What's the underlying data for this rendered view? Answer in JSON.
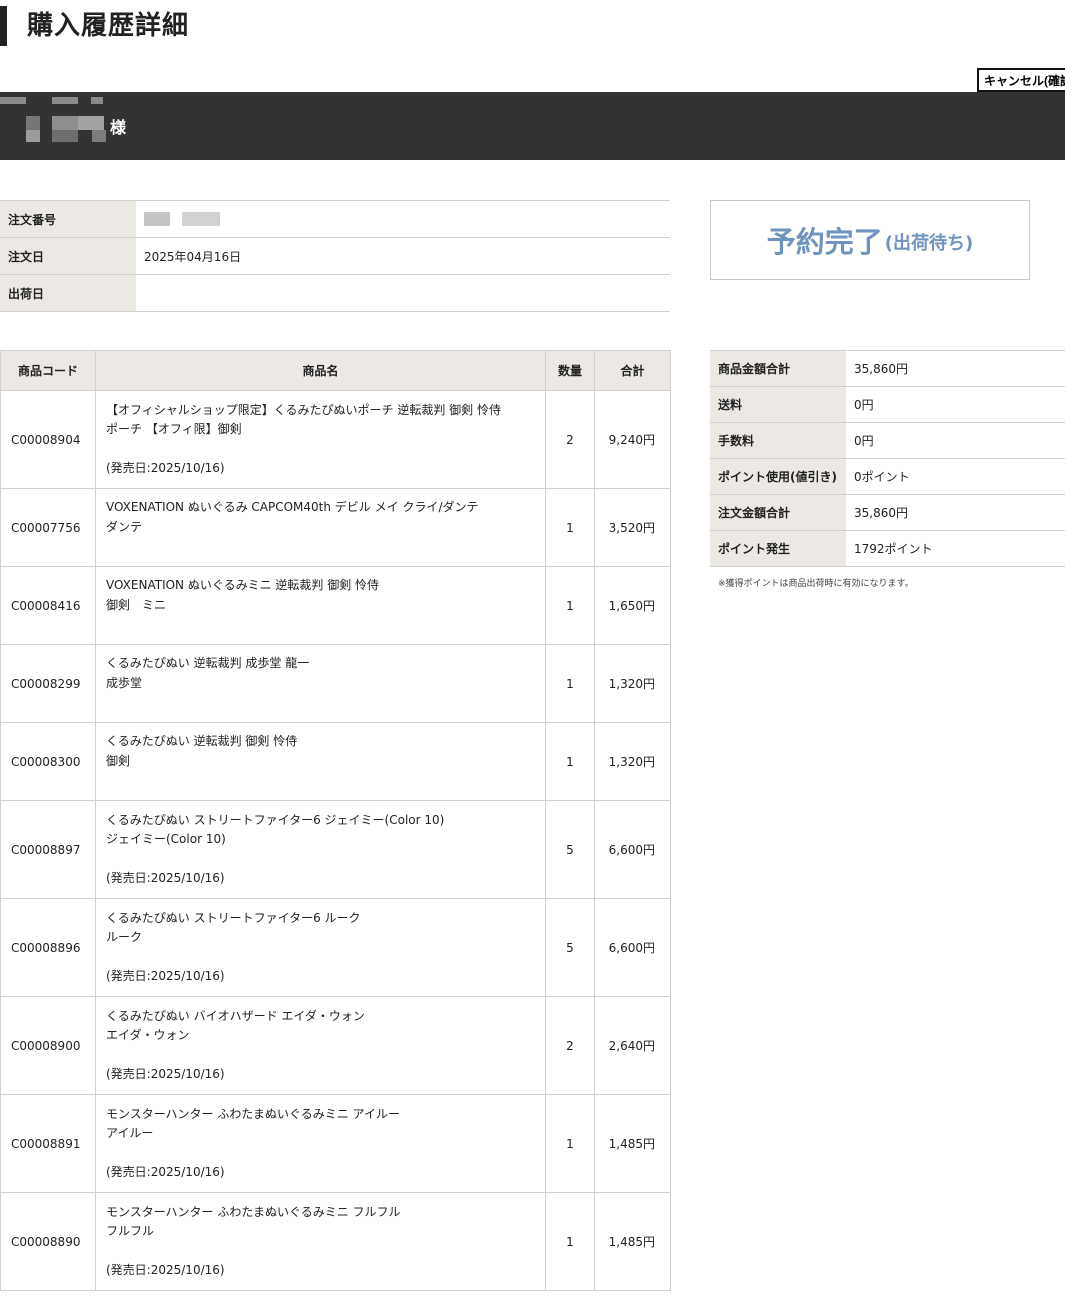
{
  "page": {
    "title": "購入履歴詳細"
  },
  "toolbar": {
    "cancel_label": "キャンセル(確認"
  },
  "customer": {
    "suffix": "様"
  },
  "order_info": {
    "order_number_label": "注文番号",
    "order_date_label": "注文日",
    "order_date": "2025年04月16日",
    "ship_date_label": "出荷日",
    "ship_date": ""
  },
  "status": {
    "main": "予約完了",
    "sub": "(出荷待ち)"
  },
  "items_table": {
    "headers": {
      "code": "商品コード",
      "name": "商品名",
      "qty": "数量",
      "total": "合計"
    },
    "rows": [
      {
        "code": "C00008904",
        "name_line1": "【オフィシャルショップ限定】くるみたぴぬいポーチ 逆転裁判 御剣 怜侍",
        "name_line2": "ポーチ 【オフィ限】御剣",
        "release": "(発売日:2025/10/16)",
        "qty": "2",
        "total": "9,240円"
      },
      {
        "code": "C00007756",
        "name_line1": "VOXENATION ぬいぐるみ CAPCOM40th デビル メイ クライ/ダンテ",
        "name_line2": "ダンテ",
        "release": "",
        "qty": "1",
        "total": "3,520円"
      },
      {
        "code": "C00008416",
        "name_line1": "VOXENATION ぬいぐるみミニ 逆転裁判 御剣 怜侍",
        "name_line2": "御剣　ミニ",
        "release": "",
        "qty": "1",
        "total": "1,650円"
      },
      {
        "code": "C00008299",
        "name_line1": "くるみたぴぬい 逆転裁判 成歩堂 龍一",
        "name_line2": "成歩堂",
        "release": "",
        "qty": "1",
        "total": "1,320円"
      },
      {
        "code": "C00008300",
        "name_line1": "くるみたぴぬい 逆転裁判 御剣 怜侍",
        "name_line2": "御剣",
        "release": "",
        "qty": "1",
        "total": "1,320円"
      },
      {
        "code": "C00008897",
        "name_line1": "くるみたぴぬい ストリートファイター6 ジェイミー(Color 10)",
        "name_line2": "ジェイミー(Color 10)",
        "release": "(発売日:2025/10/16)",
        "qty": "5",
        "total": "6,600円"
      },
      {
        "code": "C00008896",
        "name_line1": "くるみたぴぬい ストリートファイター6 ルーク",
        "name_line2": "ルーク",
        "release": "(発売日:2025/10/16)",
        "qty": "5",
        "total": "6,600円"
      },
      {
        "code": "C00008900",
        "name_line1": "くるみたぴぬい バイオハザード エイダ・ウォン",
        "name_line2": "エイダ・ウォン",
        "release": "(発売日:2025/10/16)",
        "qty": "2",
        "total": "2,640円"
      },
      {
        "code": "C00008891",
        "name_line1": "モンスターハンター ふわたまぬいぐるみミニ アイルー",
        "name_line2": "アイルー",
        "release": "(発売日:2025/10/16)",
        "qty": "1",
        "total": "1,485円"
      },
      {
        "code": "C00008890",
        "name_line1": "モンスターハンター ふわたまぬいぐるみミニ フルフル",
        "name_line2": "フルフル",
        "release": "(発売日:2025/10/16)",
        "qty": "1",
        "total": "1,485円"
      }
    ]
  },
  "totals": {
    "rows": [
      {
        "label": "商品金額合計",
        "value": "35,860円"
      },
      {
        "label": "送料",
        "value": "0円"
      },
      {
        "label": "手数料",
        "value": "0円"
      },
      {
        "label": "ポイント使用(値引き)",
        "value": "0ポイント"
      },
      {
        "label": "注文金額合計",
        "value": "35,860円"
      },
      {
        "label": "ポイント発生",
        "value": "1792ポイント"
      }
    ],
    "note": "※獲得ポイントは商品出荷時に有効になります。"
  }
}
